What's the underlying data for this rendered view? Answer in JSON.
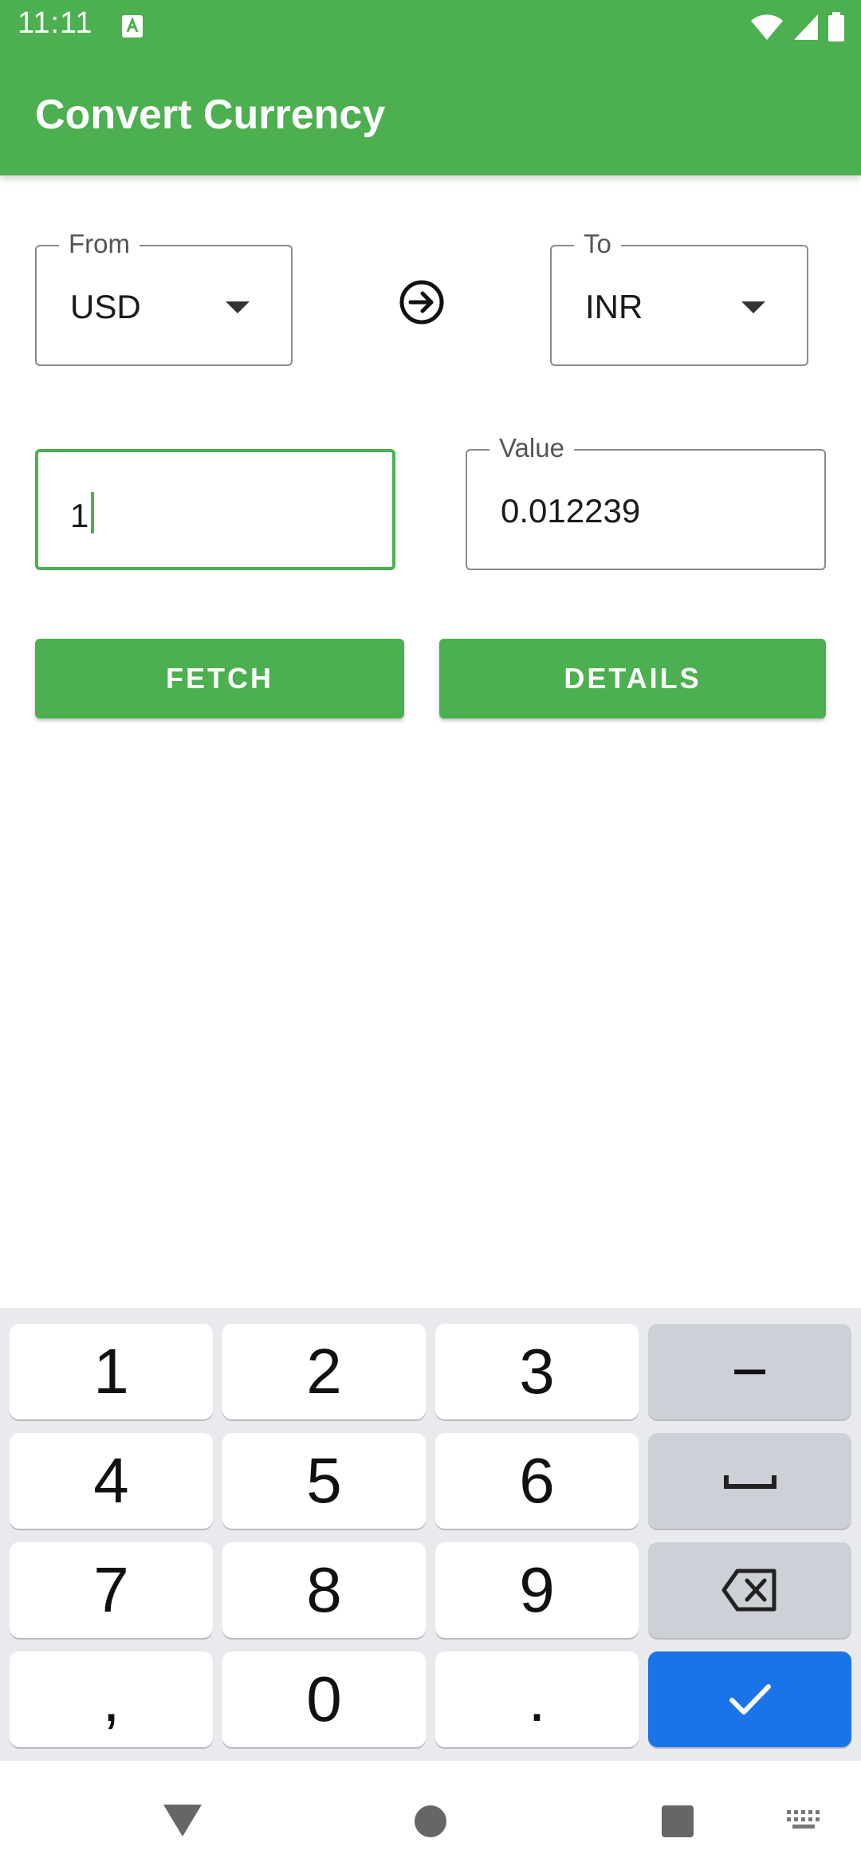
{
  "status_bar": {
    "time": "11:11",
    "notification_icon": "keyboard-a-icon",
    "icons": [
      "wifi-icon",
      "signal-icon",
      "battery-icon"
    ]
  },
  "toolbar": {
    "title": "Convert Currency"
  },
  "from": {
    "label": "From",
    "value": "USD"
  },
  "to": {
    "label": "To",
    "value": "INR"
  },
  "amount_input": {
    "value": "1"
  },
  "result": {
    "label": "Value",
    "value": "0.012239"
  },
  "buttons": {
    "fetch": "FETCH",
    "details": "DETAILS"
  },
  "keyboard": {
    "row1": [
      "1",
      "2",
      "3",
      "−"
    ],
    "row2": [
      "4",
      "5",
      "6"
    ],
    "row3": [
      "7",
      "8",
      "9"
    ],
    "row4": [
      ",",
      "0",
      "."
    ],
    "fn_icons": [
      "space-icon",
      "backspace-icon",
      "check-icon"
    ]
  },
  "navbar": {
    "icons": [
      "back-icon",
      "home-icon",
      "recents-icon",
      "keyboard-switch-icon"
    ]
  },
  "colors": {
    "primary": "#4CAF50",
    "accent": "#1a73e8",
    "key_fn": "#cdd0d6",
    "keyboard_bg": "#e8eaed"
  }
}
